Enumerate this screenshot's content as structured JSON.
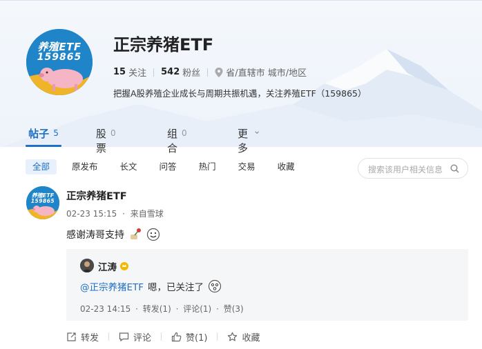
{
  "profile": {
    "name": "正宗养猪ETF",
    "following_count": "15",
    "following_label": "关注",
    "followers_count": "542",
    "followers_label": "粉丝",
    "location": "省/直辖市 城市/地区",
    "bio": "把握A股养殖企业成长与周期共振机遇，关注养殖ETF（159865）",
    "avatar_line1": "养殖ETF",
    "avatar_line2": "159865"
  },
  "tabs": [
    {
      "label": "帖子",
      "count": "5",
      "active": true
    },
    {
      "label": "股票",
      "count": "0"
    },
    {
      "label": "组合",
      "count": "0"
    },
    {
      "label": "更多"
    }
  ],
  "filters": [
    "全部",
    "原发布",
    "长文",
    "问答",
    "热门",
    "交易",
    "收藏"
  ],
  "search": {
    "placeholder": "搜索该用户相关信息"
  },
  "post": {
    "author": "正宗养猪ETF",
    "time": "02-23 15:15",
    "source": "来自雪球",
    "text": "感谢涛哥支持",
    "quote": {
      "author": "江涛",
      "mention": "@正宗养猪ETF",
      "text": "嗯，已关注了",
      "time": "02-23 14:15",
      "repost": "转发(1)",
      "comment": "评论(1)",
      "like": "赞(3)"
    },
    "actions": {
      "repost": "转发",
      "comment": "评论",
      "like": "赞(1)",
      "favorite": "收藏"
    }
  },
  "colors": {
    "accent": "#1e6fc6",
    "avatar_bg": "#1f84c8"
  },
  "icons": [
    "location-icon",
    "chevron-down-icon",
    "search-icon",
    "repost-icon",
    "comment-icon",
    "like-icon",
    "star-icon"
  ]
}
